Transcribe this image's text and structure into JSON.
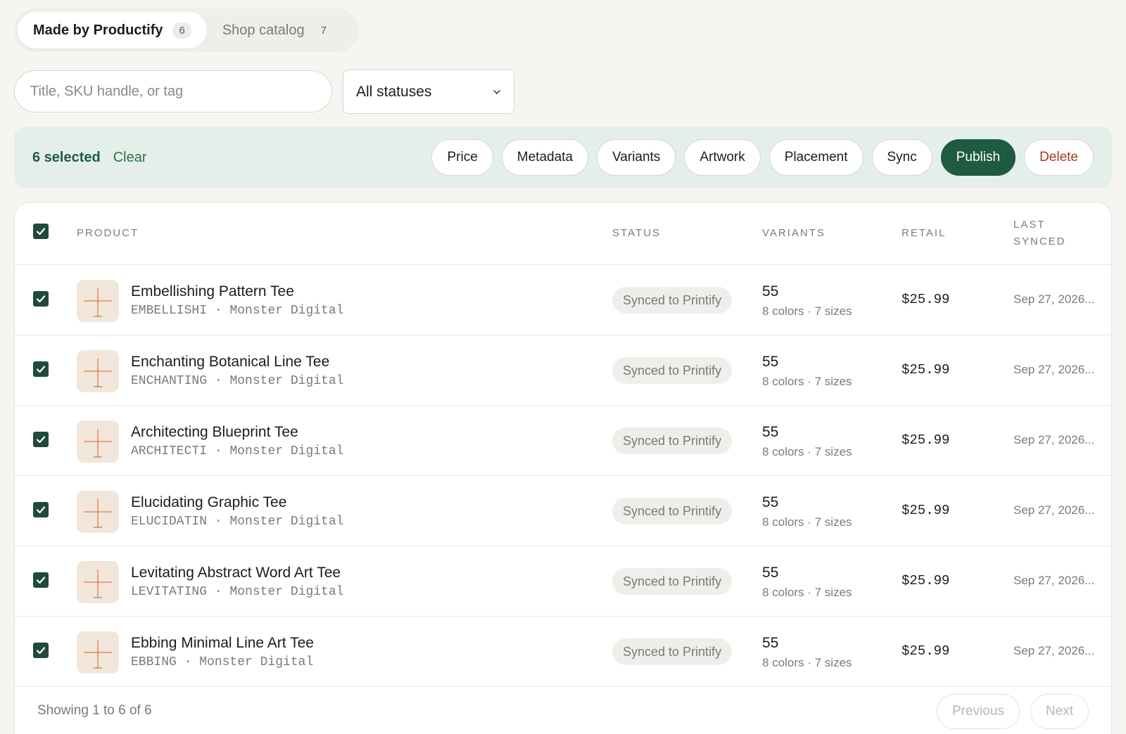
{
  "tabs": [
    {
      "label": "Made by Productify",
      "count": "6"
    },
    {
      "label": "Shop catalog",
      "count": "7"
    }
  ],
  "filters": {
    "search_placeholder": "Title, SKU handle, or tag",
    "status_value": "All statuses"
  },
  "bulk": {
    "selected_label": "6 selected",
    "clear_label": "Clear",
    "actions": [
      "Price",
      "Metadata",
      "Variants",
      "Artwork",
      "Placement",
      "Sync",
      "Publish",
      "Delete"
    ]
  },
  "table": {
    "headers": {
      "product": "PRODUCT",
      "status": "STATUS",
      "variants": "VARIANTS",
      "retail": "RETAIL",
      "last_synced_line1": "LAST",
      "last_synced_line2": "SYNCED"
    },
    "rows": [
      {
        "title": "Embellishing Pattern Tee",
        "sku": "EMBELLISHI",
        "brand": "Monster Digital",
        "status": "Synced to Printify",
        "variants": "55",
        "variant_detail": "8 colors · 7 sizes",
        "retail": "$25.99",
        "last_synced": "Sep 27, 2026..."
      },
      {
        "title": "Enchanting Botanical Line Tee",
        "sku": "ENCHANTING",
        "brand": "Monster Digital",
        "status": "Synced to Printify",
        "variants": "55",
        "variant_detail": "8 colors · 7 sizes",
        "retail": "$25.99",
        "last_synced": "Sep 27, 2026..."
      },
      {
        "title": "Architecting Blueprint Tee",
        "sku": "ARCHITECTI",
        "brand": "Monster Digital",
        "status": "Synced to Printify",
        "variants": "55",
        "variant_detail": "8 colors · 7 sizes",
        "retail": "$25.99",
        "last_synced": "Sep 27, 2026..."
      },
      {
        "title": "Elucidating Graphic Tee",
        "sku": "ELUCIDATIN",
        "brand": "Monster Digital",
        "status": "Synced to Printify",
        "variants": "55",
        "variant_detail": "8 colors · 7 sizes",
        "retail": "$25.99",
        "last_synced": "Sep 27, 2026..."
      },
      {
        "title": "Levitating Abstract Word Art Tee",
        "sku": "LEVITATING",
        "brand": "Monster Digital",
        "status": "Synced to Printify",
        "variants": "55",
        "variant_detail": "8 colors · 7 sizes",
        "retail": "$25.99",
        "last_synced": "Sep 27, 2026..."
      },
      {
        "title": "Ebbing Minimal Line Art Tee",
        "sku": "EBBING",
        "brand": "Monster Digital",
        "status": "Synced to Printify",
        "variants": "55",
        "variant_detail": "8 colors · 7 sizes",
        "retail": "$25.99",
        "last_synced": "Sep 27, 2026..."
      }
    ]
  },
  "footer": {
    "showing": "Showing 1 to 6 of 6",
    "previous": "Previous",
    "next": "Next"
  },
  "colors": {
    "accent": "#1f5a43",
    "danger": "#a33a2a",
    "background": "#f6f5f1",
    "bulkbar": "#e5efea"
  },
  "icons": {
    "checkbox": "checkmark-icon",
    "thumbnail": "product-placeholder-icon",
    "dropdown": "chevron-down-icon"
  }
}
